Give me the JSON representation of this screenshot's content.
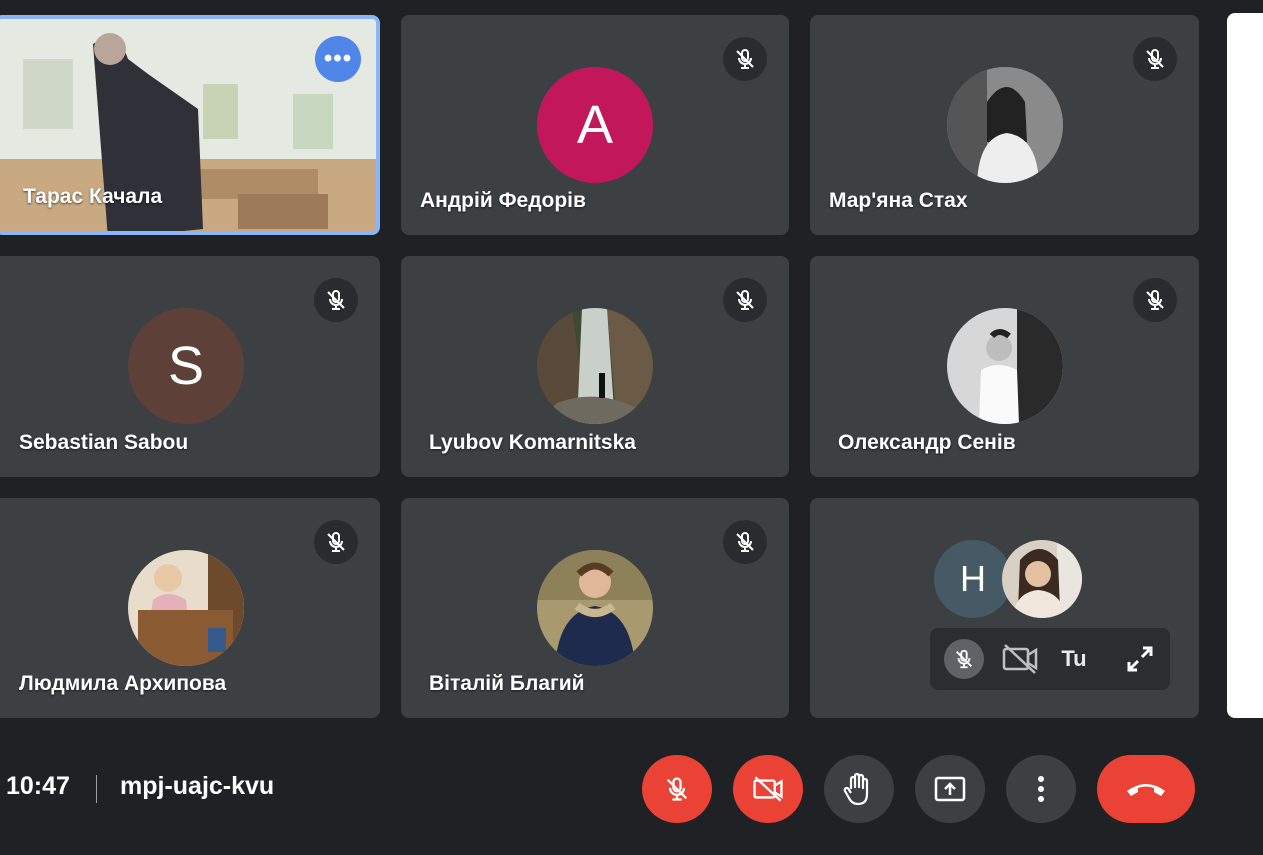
{
  "tiles": [
    {
      "name": "Тарас Качала"
    },
    {
      "name": "Андрій Федорів",
      "avatar_letter": "A",
      "avatar_color": "#c2185b"
    },
    {
      "name": "Мар'яна Стах"
    },
    {
      "name": "Sebastian Sabou",
      "avatar_letter": "S",
      "avatar_color": "#5d4037"
    },
    {
      "name": "Lyubov Komarnitska"
    },
    {
      "name": "Олександр Сенів"
    },
    {
      "name": "Людмила Архипова"
    },
    {
      "name": "Віталій Благий"
    }
  ],
  "self_tile": {
    "avatar_letter": "H",
    "avatar_color": "#455a64",
    "you_label": "Tu"
  },
  "bottom_bar": {
    "time": "10:47",
    "meeting_code": "mpj-uajc-kvu"
  },
  "colors": {
    "background": "#202124",
    "tile": "#3c4043",
    "accent_blue": "#8ab4f8",
    "danger_red": "#ea4335"
  },
  "icons": [
    "more-icon",
    "mic-off-icon",
    "camera-off-icon",
    "raise-hand-icon",
    "present-icon",
    "more-vert-icon",
    "call-end-icon",
    "expand-icon"
  ]
}
